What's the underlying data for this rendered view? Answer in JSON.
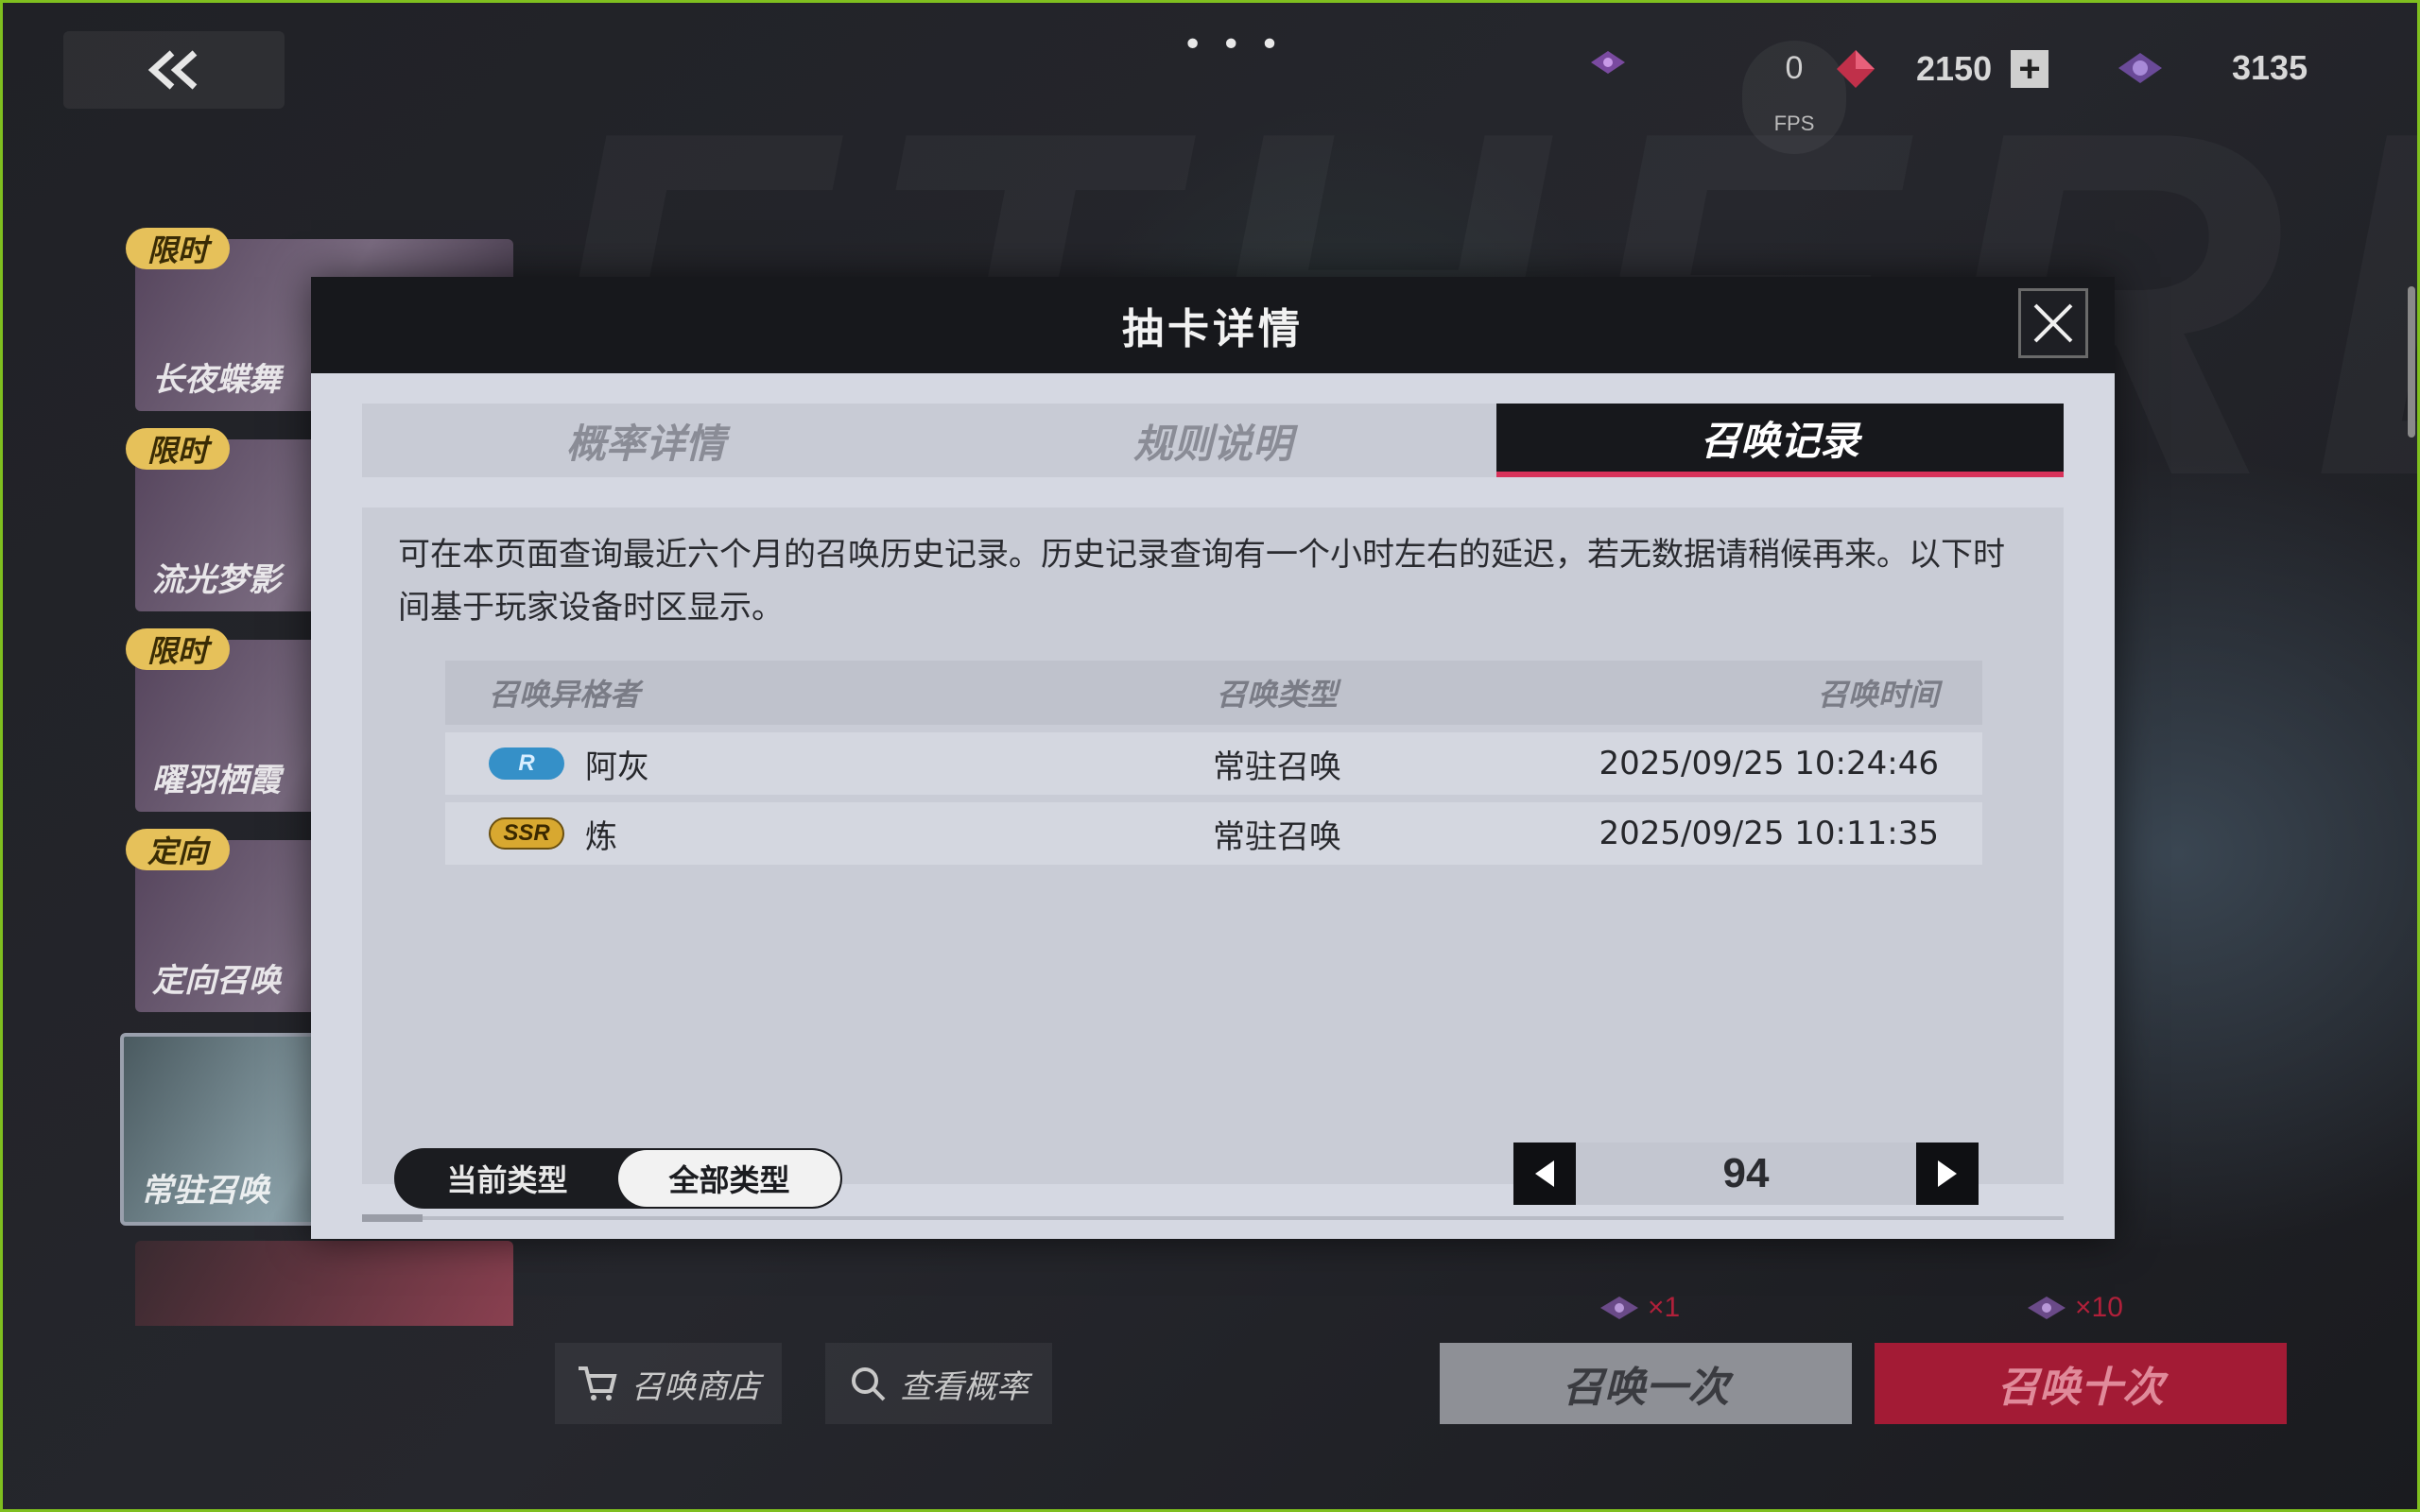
{
  "top": {
    "menu_dots": "• • •"
  },
  "resources": {
    "fps_value": "0",
    "fps_label": "FPS",
    "gems": "2150",
    "tickets": "3135"
  },
  "banners": [
    {
      "tag": "限时",
      "name": "长夜蝶舞"
    },
    {
      "tag": "限时",
      "name": "流光梦影"
    },
    {
      "tag": "限时",
      "name": "曜羽栖霞"
    },
    {
      "tag": "定向",
      "name": "定向召唤"
    },
    {
      "tag": "",
      "name": "常驻召唤"
    }
  ],
  "bottom": {
    "shop_label": "召唤商店",
    "rates_label": "查看概率",
    "summon_once": "召唤一次",
    "summon_ten": "召唤十次",
    "cost_once": "×1",
    "cost_ten": "×10"
  },
  "modal": {
    "title": "抽卡详情",
    "tabs": [
      "概率详情",
      "规则说明",
      "召唤记录"
    ],
    "active_tab": 2,
    "description": "可在本页面查询最近六个月的召唤历史记录。历史记录查询有一个小时左右的延迟，若无数据请稍候再来。以下时间基于玩家设备时区显示。",
    "columns": [
      "召唤异格者",
      "召唤类型",
      "召唤时间"
    ],
    "rows": [
      {
        "rarity": "R",
        "name": "阿灰",
        "type": "常驻召唤",
        "time": "2025/09/25 10:24:46"
      },
      {
        "rarity": "SSR",
        "name": "炼",
        "type": "常驻召唤",
        "time": "2025/09/25 10:11:35"
      }
    ],
    "filter": {
      "current": "当前类型",
      "all": "全部类型",
      "selected": "all"
    },
    "page": "94"
  },
  "colors": {
    "accent": "#d8325a",
    "summon_ten_bg": "#a31b35",
    "summon_once_bg": "#8e9096",
    "frame": "#7fbf1f"
  }
}
